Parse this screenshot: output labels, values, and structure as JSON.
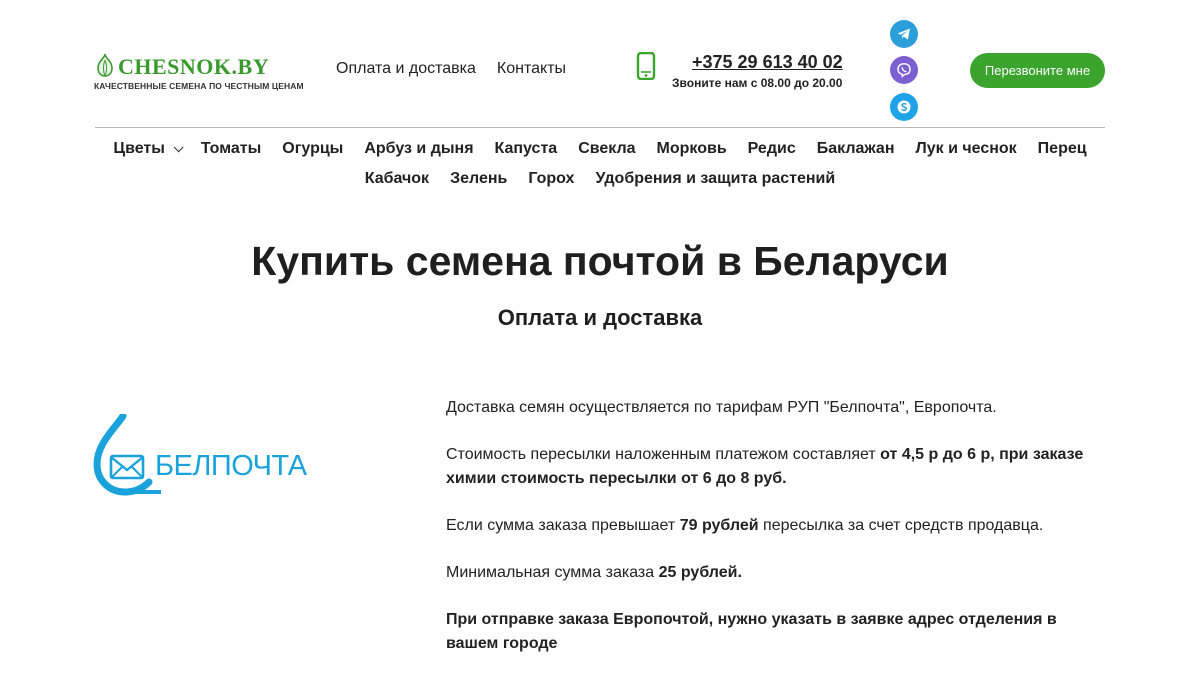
{
  "header": {
    "logo_title": "CHESNOK.BY",
    "logo_subtitle": "КАЧЕСТВЕННЫЕ СЕМЕНА ПО ЧЕСТНЫМ ЦЕНАМ",
    "links": [
      "Оплата и доставка",
      "Контакты"
    ],
    "phone": "+375 29 613 40 02",
    "hours": "Звоните нам с 08.00 до 20.00",
    "social_icons": [
      "telegram-icon",
      "viber-icon",
      "skype-icon"
    ],
    "callback_label": "Перезвоните мне"
  },
  "nav": {
    "row1": [
      "Цветы",
      "Томаты",
      "Огурцы",
      "Арбуз и дыня",
      "Капуста",
      "Свекла",
      "Морковь",
      "Редис",
      "Баклажан",
      "Лук и чеснок",
      "Перец"
    ],
    "row2": [
      "Кабачок",
      "Зелень",
      "Горох",
      "Удобрения и защита растений"
    ]
  },
  "main": {
    "title": "Купить семена почтой в Беларуси",
    "subtitle": "Оплата и доставка",
    "logo_text": "БЕЛПОЧТА",
    "p1": "Доставка семян осуществляется по тарифам РУП \"Белпочта\", Европочта.",
    "p2_text": "Стоимость пересылки наложенным платежом составляет ",
    "p2_bold": "от 4,5 р до 6 р, при заказе химии стоимость пересылки от 6 до 8 руб.",
    "p3_text1": "Если сумма заказа превышает ",
    "p3_bold": "79 рублей",
    "p3_text2": " пересылка за счет средств продавца.",
    "p4_text": "Минимальная сумма заказа ",
    "p4_bold": "25 рублей.",
    "p5_bold": "При отправке заказа Европочтой, нужно указать в заявке адрес отделения в вашем городе"
  },
  "colors": {
    "brand_green": "#3aa42d",
    "belpochta_blue": "#1aa3db",
    "telegram": "#2b9fd9",
    "viber": "#7c5fd0",
    "skype": "#1ea3e8"
  }
}
